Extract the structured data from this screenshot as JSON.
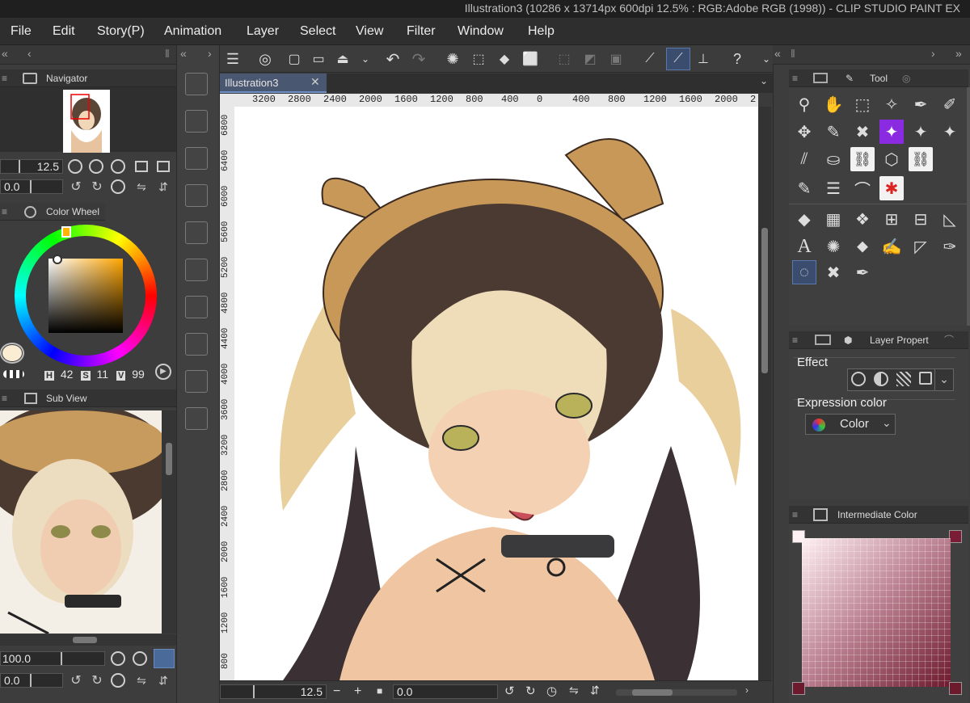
{
  "window": {
    "title": "Illustration3 (10286 x 13714px 600dpi 12.5% : RGB:Adobe RGB (1998)) - CLIP STUDIO PAINT EX"
  },
  "menu": [
    "File",
    "Edit",
    "Story(P)",
    "Animation",
    "Layer",
    "Select",
    "View",
    "Filter",
    "Window",
    "Help"
  ],
  "navigator": {
    "title": "Navigator",
    "zoom": "12.5",
    "angle": "0.0"
  },
  "color_wheel": {
    "title": "Color Wheel",
    "h_label": "H",
    "h": "42",
    "s_label": "S",
    "s": "11",
    "v_label": "V",
    "v": "99",
    "main_color": "#fbecd4"
  },
  "sub_view": {
    "title": "Sub View",
    "zoom": "100.0",
    "angle": "0.0"
  },
  "document": {
    "tab": "Illustration3",
    "zoom": "12.5",
    "angle": "0.0"
  },
  "ruler": {
    "h_ticks": [
      "3200",
      "2800",
      "2400",
      "2000",
      "1600",
      "1200",
      "800",
      "400",
      "0",
      "400",
      "800",
      "1200",
      "1600",
      "2000",
      "2"
    ],
    "v_ticks": [
      "6800",
      "6400",
      "6000",
      "5600",
      "5200",
      "4800",
      "4400",
      "4000",
      "3600",
      "3200",
      "2800",
      "2400",
      "2000",
      "1600",
      "1200",
      "800"
    ]
  },
  "tool_panel": {
    "title": "Tool"
  },
  "layer_property": {
    "title": "Layer Propert",
    "effect_label": "Effect",
    "expression_label": "Expression color",
    "expression_value": "Color"
  },
  "intermediate_color": {
    "title": "Intermediate Color",
    "corner_tl": "#fff0f4",
    "corner_tr": "#7a1c34",
    "corner_bl": "#6e1a2e",
    "corner_br": "#6e1a2e"
  },
  "colors": {
    "accent": "#8a2be2",
    "selected_tool": "#3a4d6e"
  }
}
